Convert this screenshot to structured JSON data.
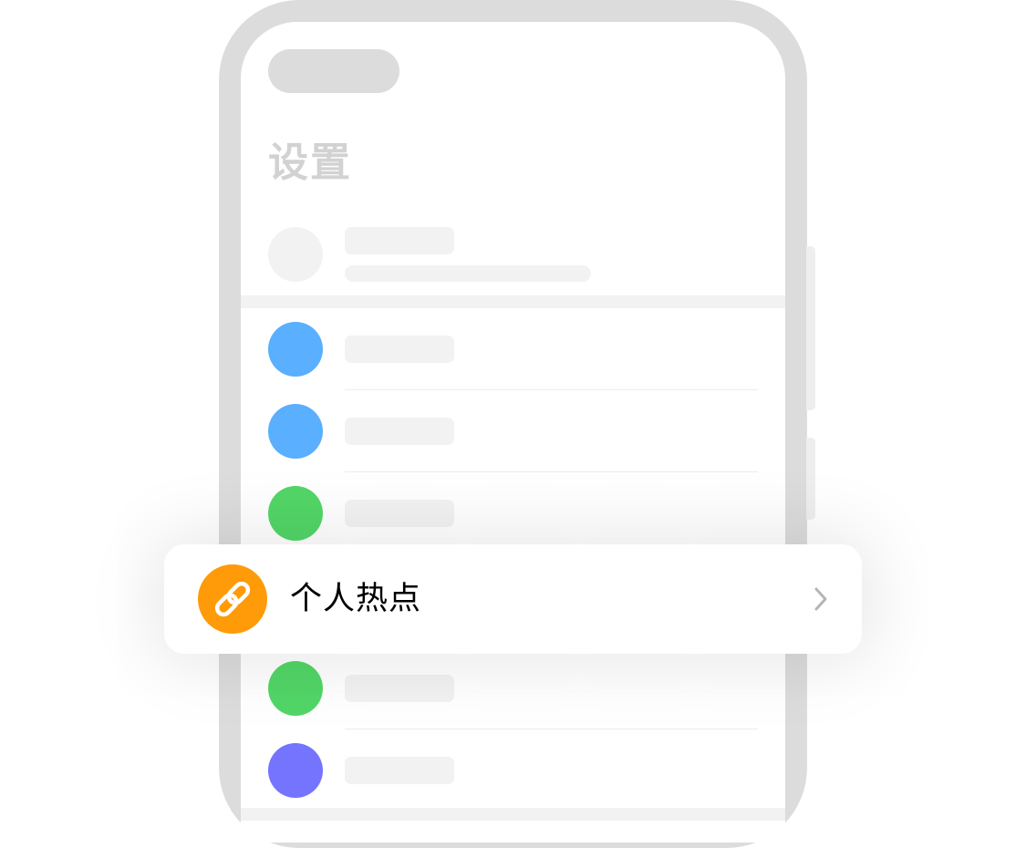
{
  "settings": {
    "title": "设置"
  },
  "colors": {
    "frame": "#dcdcdc",
    "placeholder": "#f2f2f2",
    "accent_blue": "#5aafff",
    "accent_green": "#52d667",
    "accent_purple": "#7474ff",
    "hotspot_orange": "#ff9a08",
    "chevron": "#b5b5b5"
  },
  "rows": [
    {
      "icon": "blue-circle-icon",
      "color": "#5aafff"
    },
    {
      "icon": "blue-circle-icon",
      "color": "#5aafff"
    },
    {
      "icon": "green-circle-icon",
      "color": "#52d667"
    },
    {
      "icon": "green-circle-icon",
      "color": "#52d667"
    },
    {
      "icon": "purple-circle-icon",
      "color": "#7474ff"
    }
  ],
  "hotspot": {
    "label": "个人热点",
    "icon": "link-icon",
    "chevron": "chevron-right-icon"
  }
}
